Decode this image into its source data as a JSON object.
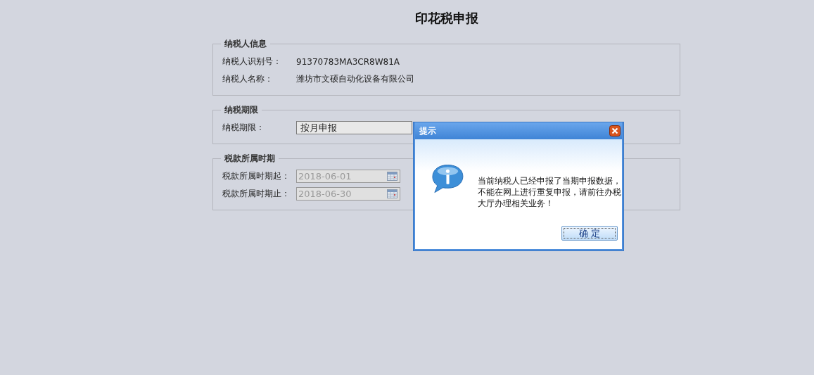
{
  "page_title": "印花税申报",
  "sections": [
    {
      "legend": "纳税人信息",
      "rows": [
        {
          "kind": "text",
          "label": "纳税人识别号：",
          "value": "91370783MA3CR8W81A"
        },
        {
          "kind": "text",
          "label": "纳税人名称：",
          "value": "潍坊市文硕自动化设备有限公司"
        }
      ]
    },
    {
      "legend": "纳税期限",
      "rows": [
        {
          "kind": "select",
          "label": "纳税期限：",
          "value": "按月申报",
          "disabled": false
        }
      ]
    },
    {
      "legend": "税款所属时期",
      "rows": [
        {
          "kind": "date",
          "label": "税款所属时期起：",
          "value": "2018-06-01",
          "disabled": true
        },
        {
          "kind": "date",
          "label": "税款所属时期止：",
          "value": "2018-06-30",
          "disabled": true
        }
      ]
    }
  ],
  "dialog": {
    "title": "提示",
    "message": "当前纳税人已经申报了当期申报数据，不能在网上进行重复申报，请前往办税大厅办理相关业务！",
    "buttons": [
      "确 定"
    ]
  }
}
